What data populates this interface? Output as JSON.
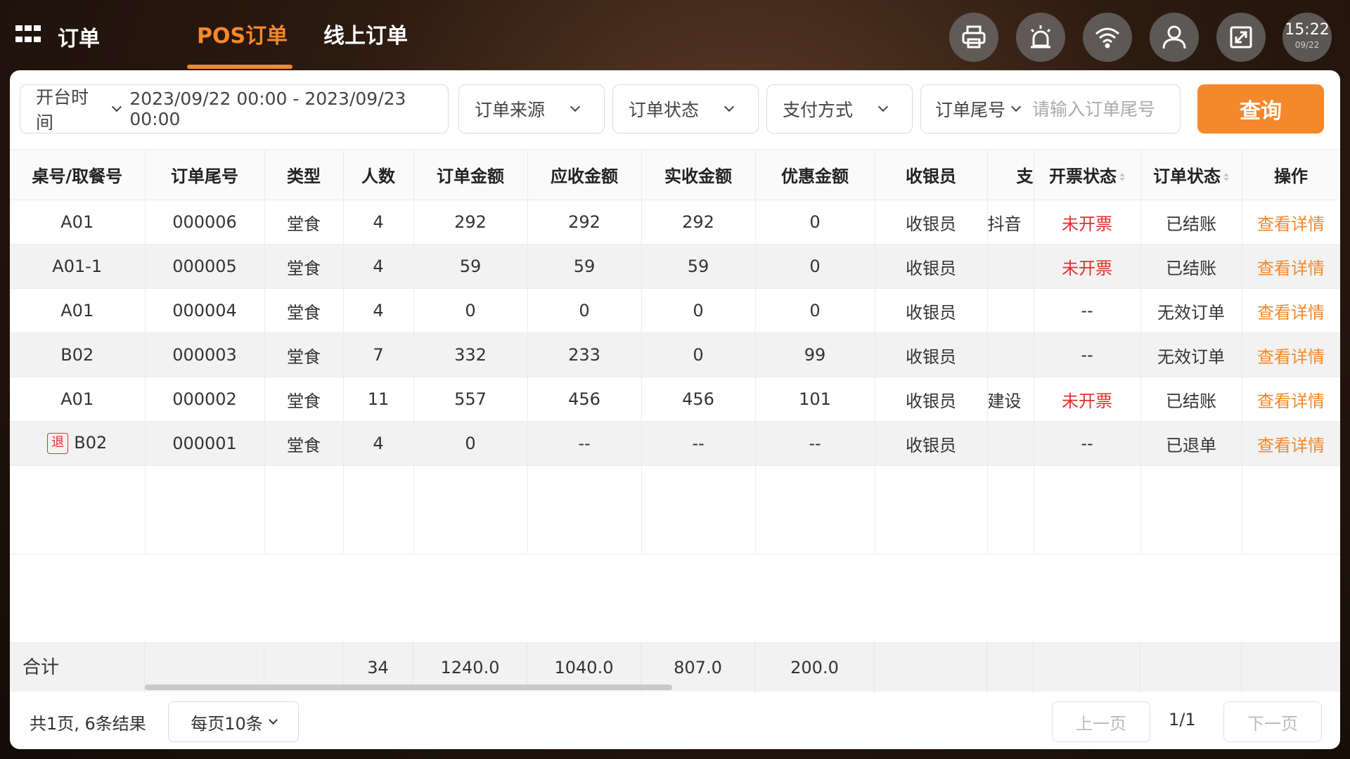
{
  "header": {
    "title": "订单",
    "tabs": [
      {
        "label": "POS订单",
        "active": true
      },
      {
        "label": "线上订单",
        "active": false
      }
    ],
    "icons": [
      "printer-icon",
      "alarm-icon",
      "wifi-icon",
      "user-icon",
      "fullscreen-icon"
    ],
    "clock": {
      "time": "15:22",
      "date": "09/22"
    },
    "accent_color": "#f5882a"
  },
  "filters": {
    "time_label": "开台时间",
    "time_range": "2023/09/22 00:00 - 2023/09/23 00:00",
    "source_label": "订单来源",
    "status_label": "订单状态",
    "payment_label": "支付方式",
    "suffix_label": "订单尾号",
    "suffix_placeholder": "请输入订单尾号",
    "query_label": "查询"
  },
  "table": {
    "columns": [
      "桌号/取餐号",
      "订单尾号",
      "类型",
      "人数",
      "订单金额",
      "应收金额",
      "实收金额",
      "优惠金额",
      "收银员",
      "支",
      "开票状态",
      "订单状态",
      "操作"
    ],
    "rows": [
      {
        "table_no": "A01",
        "suffix": "000006",
        "type": "堂食",
        "people": "4",
        "order_amount": "292",
        "receivable": "292",
        "received": "292",
        "discount": "0",
        "cashier": "收银员",
        "payment": "抖音",
        "invoice": "未开票",
        "status": "已结账",
        "action": "查看详情",
        "refund_tag": ""
      },
      {
        "table_no": "A01-1",
        "suffix": "000005",
        "type": "堂食",
        "people": "4",
        "order_amount": "59",
        "receivable": "59",
        "received": "59",
        "discount": "0",
        "cashier": "收银员",
        "payment": "",
        "invoice": "未开票",
        "status": "已结账",
        "action": "查看详情",
        "refund_tag": ""
      },
      {
        "table_no": "A01",
        "suffix": "000004",
        "type": "堂食",
        "people": "4",
        "order_amount": "0",
        "receivable": "0",
        "received": "0",
        "discount": "0",
        "cashier": "收银员",
        "payment": "",
        "invoice": "--",
        "status": "无效订单",
        "action": "查看详情",
        "refund_tag": ""
      },
      {
        "table_no": "B02",
        "suffix": "000003",
        "type": "堂食",
        "people": "7",
        "order_amount": "332",
        "receivable": "233",
        "received": "0",
        "discount": "99",
        "cashier": "收银员",
        "payment": "",
        "invoice": "--",
        "status": "无效订单",
        "action": "查看详情",
        "refund_tag": ""
      },
      {
        "table_no": "A01",
        "suffix": "000002",
        "type": "堂食",
        "people": "11",
        "order_amount": "557",
        "receivable": "456",
        "received": "456",
        "discount": "101",
        "cashier": "收银员",
        "payment": "建设",
        "invoice": "未开票",
        "status": "已结账",
        "action": "查看详情",
        "refund_tag": ""
      },
      {
        "table_no": "B02",
        "suffix": "000001",
        "type": "堂食",
        "people": "4",
        "order_amount": "0",
        "receivable": "--",
        "received": "--",
        "discount": "--",
        "cashier": "收银员",
        "payment": "",
        "invoice": "--",
        "status": "已退单",
        "action": "查看详情",
        "refund_tag": "退"
      }
    ]
  },
  "totals": {
    "label": "合计",
    "people": "34",
    "order_amount": "1240.0",
    "receivable": "1040.0",
    "received": "807.0",
    "discount": "200.0"
  },
  "pagination": {
    "summary": "共1页, 6条结果",
    "page_size": "每页10条",
    "prev": "上一页",
    "page": "1/1",
    "next": "下一页"
  }
}
